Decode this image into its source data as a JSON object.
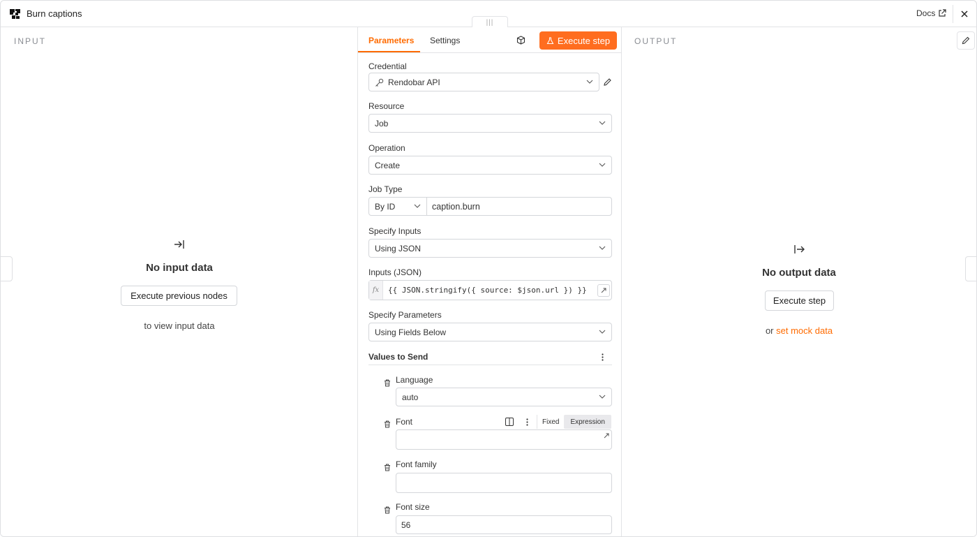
{
  "header": {
    "title": "Burn captions",
    "docs_label": "Docs"
  },
  "input_panel": {
    "label": "INPUT",
    "empty_title": "No input data",
    "button_label": "Execute previous nodes",
    "subtext": "to view input data"
  },
  "tabs": {
    "parameters": "Parameters",
    "settings": "Settings",
    "execute_label": "Execute step"
  },
  "form": {
    "credential": {
      "label": "Credential",
      "value": "Rendobar API"
    },
    "resource": {
      "label": "Resource",
      "value": "Job"
    },
    "operation": {
      "label": "Operation",
      "value": "Create"
    },
    "job_type": {
      "label": "Job Type",
      "mode": "By ID",
      "value": "caption.burn"
    },
    "specify_inputs": {
      "label": "Specify Inputs",
      "value": "Using JSON"
    },
    "inputs_json": {
      "label": "Inputs (JSON)",
      "fx": "fx",
      "value": "{{ JSON.stringify({ source: $json.url }) }}"
    },
    "specify_parameters": {
      "label": "Specify Parameters",
      "value": "Using Fields Below"
    },
    "values_to_send": {
      "label": "Values to Send"
    },
    "language": {
      "label": "Language",
      "value": "auto"
    },
    "font": {
      "label": "Font",
      "fixed_label": "Fixed",
      "expression_label": "Expression",
      "value": ""
    },
    "font_family": {
      "label": "Font family",
      "value": ""
    },
    "font_size": {
      "label": "Font size",
      "value": "56"
    }
  },
  "output_panel": {
    "label": "OUTPUT",
    "empty_title": "No output data",
    "button_label": "Execute step",
    "or_text": "or",
    "mock_link": "set mock data"
  },
  "colors": {
    "accent": "#ff6b00",
    "border": "#d4d6da"
  }
}
